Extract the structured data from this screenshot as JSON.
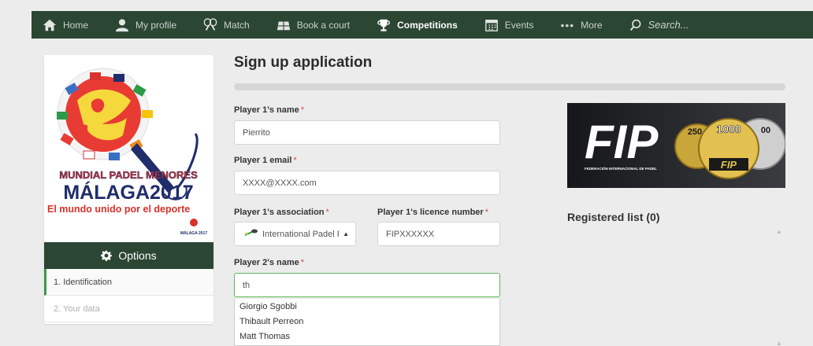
{
  "nav": {
    "home": "Home",
    "profile": "My profile",
    "match": "Match",
    "book": "Book a court",
    "competitions": "Competitions",
    "events": "Events",
    "more": "More",
    "search_placeholder": "Search..."
  },
  "logo": {
    "line1": "MUNDIAL PADEL MENORES",
    "line2": "MÁLAGA2017",
    "line3": "El mundo unido por el deporte",
    "badge_line1": "MÁLAGA 2017"
  },
  "sidebar": {
    "options_label": "Options",
    "items": [
      {
        "label": "1. Identification",
        "state": "active"
      },
      {
        "label": "2. Your data",
        "state": "disabled"
      }
    ]
  },
  "form": {
    "title": "Sign up application",
    "player1_name_label": "Player 1's name",
    "player1_name_value": "Pierrito",
    "player1_email_label": "Player 1 email",
    "player1_email_value": "XXXX@XXXX.com",
    "player1_association_label": "Player 1's association",
    "player1_association_value": "International Padel F",
    "player1_licence_label": "Player 1's licence number",
    "player1_licence_value": "FIPXXXXXX",
    "player2_name_label": "Player 2's name",
    "player2_name_value": "th",
    "required_mark": "*",
    "suggestions": [
      "Giorgio Sgobbi",
      "Thibault Perreon",
      "Matt Thomas"
    ]
  },
  "right": {
    "banner_text": "FIP",
    "banner_subtitle": "FEDERACIÓN INTERNACIONAL DE PADEL",
    "coin_values": [
      "250",
      "1000",
      "00"
    ],
    "coin_label": "FIP",
    "registered_title": "Registered list (0)"
  },
  "colors": {
    "nav_bg": "#2c4634",
    "accent_green": "#3a9a4a",
    "required_red": "#dd4444",
    "logo_red": "#d8322c",
    "logo_navy": "#1f2d6b"
  }
}
